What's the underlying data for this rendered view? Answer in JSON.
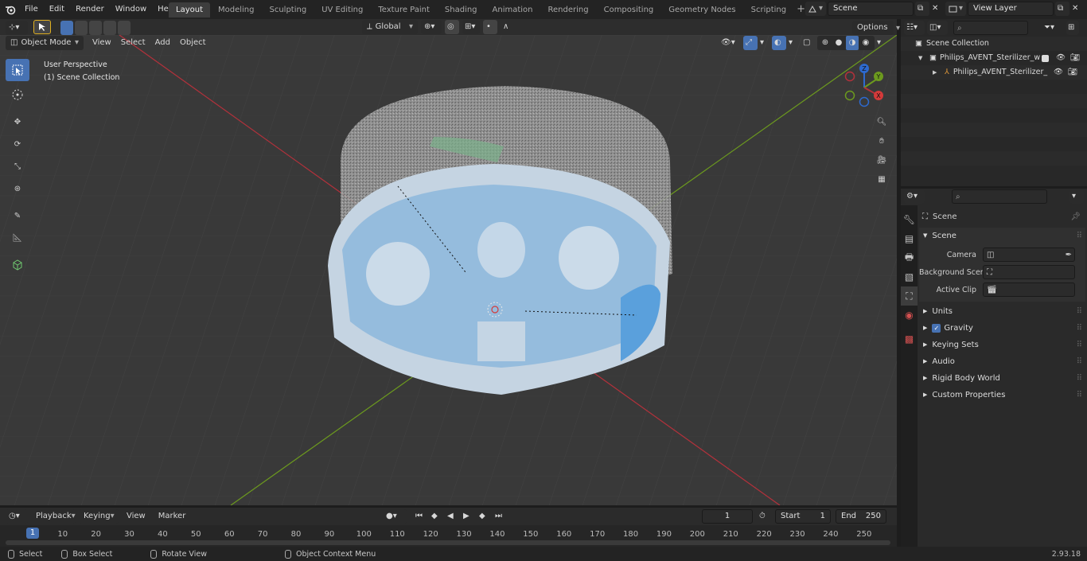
{
  "menu": {
    "items": [
      "File",
      "Edit",
      "Render",
      "Window",
      "Help"
    ]
  },
  "workspaces": [
    {
      "label": "Layout",
      "active": true
    },
    {
      "label": "Modeling"
    },
    {
      "label": "Sculpting"
    },
    {
      "label": "UV Editing"
    },
    {
      "label": "Texture Paint"
    },
    {
      "label": "Shading"
    },
    {
      "label": "Animation"
    },
    {
      "label": "Rendering"
    },
    {
      "label": "Compositing"
    },
    {
      "label": "Geometry Nodes"
    },
    {
      "label": "Scripting"
    }
  ],
  "scene_selector": {
    "value": "Scene"
  },
  "view_layer_selector": {
    "value": "View Layer"
  },
  "viewport_header": {
    "mode": "Object Mode",
    "menus": [
      "View",
      "Select",
      "Add",
      "Object"
    ],
    "transform_orientation": "Global",
    "options_label": "Options"
  },
  "viewport": {
    "overlay_line1": "User Perspective",
    "overlay_line2": "(1) Scene Collection",
    "gizmo": {
      "x": "X",
      "y": "Y",
      "z": "Z"
    }
  },
  "outliner": {
    "root": "Scene Collection",
    "items": [
      {
        "label": "Philips_AVENT_Sterilizer_with",
        "level": 1
      },
      {
        "label": "Philips_AVENT_Sterilizer_",
        "level": 2
      }
    ]
  },
  "properties": {
    "context": "Scene",
    "section": "Scene",
    "fields": [
      {
        "label": "Camera"
      },
      {
        "label": "Background Scene"
      },
      {
        "label": "Active Clip"
      }
    ],
    "panels": [
      "Units",
      "Gravity",
      "Keying Sets",
      "Audio",
      "Rigid Body World",
      "Custom Properties"
    ]
  },
  "timeline": {
    "menus": [
      "Playback",
      "Keying",
      "View",
      "Marker"
    ],
    "current_frame": "1",
    "start_label": "Start",
    "start_value": "1",
    "end_label": "End",
    "end_value": "250",
    "ticks": [
      "1",
      "10",
      "20",
      "30",
      "40",
      "50",
      "60",
      "70",
      "80",
      "90",
      "100",
      "110",
      "120",
      "130",
      "140",
      "150",
      "160",
      "170",
      "180",
      "190",
      "200",
      "210",
      "220",
      "230",
      "240",
      "250"
    ]
  },
  "statusbar": {
    "select": "Select",
    "box_select": "Box Select",
    "rotate_view": "Rotate View",
    "context_menu": "Object Context Menu",
    "version": "2.93.18"
  },
  "colors": {
    "accent": "#4772b3",
    "axis_x": "#b3313b",
    "axis_y": "#6c9a1e",
    "viewport_bg": "#393939"
  }
}
